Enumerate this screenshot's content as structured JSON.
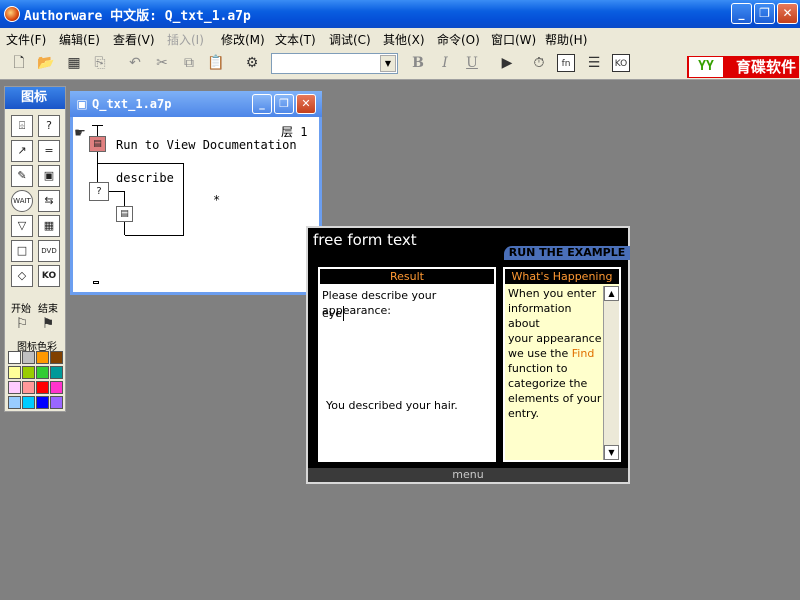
{
  "app": {
    "title": "Authorware 中文版: Q_txt_1.a7p"
  },
  "window_buttons": {
    "minimize": "_",
    "restore": "❐",
    "close": "✕"
  },
  "menu": [
    {
      "label": "文件(F)",
      "disabled": false
    },
    {
      "label": "编辑(E)",
      "disabled": false
    },
    {
      "label": "查看(V)",
      "disabled": false
    },
    {
      "label": "插入(I)",
      "disabled": true
    },
    {
      "label": "修改(M)",
      "disabled": false
    },
    {
      "label": "文本(T)",
      "disabled": false
    },
    {
      "label": "调试(C)",
      "disabled": false
    },
    {
      "label": "其他(X)",
      "disabled": false
    },
    {
      "label": "命令(O)",
      "disabled": false
    },
    {
      "label": "窗口(W)",
      "disabled": false
    },
    {
      "label": "帮助(H)",
      "disabled": false
    }
  ],
  "toolbar": {
    "font_combo_value": "",
    "bold": "B",
    "italic": "I",
    "underline": "U",
    "fn_label": "fn",
    "ko_label": "KO"
  },
  "brand": {
    "logo": "YY",
    "text": "育碟软件"
  },
  "palette": {
    "title": "图标",
    "icons": [
      {
        "name": "display-icon",
        "glyph": "⌹"
      },
      {
        "name": "decision-icon",
        "glyph": "?"
      },
      {
        "name": "motion-icon",
        "glyph": "↗"
      },
      {
        "name": "interaction-icon",
        "glyph": "="
      },
      {
        "name": "erase-icon",
        "glyph": "✎"
      },
      {
        "name": "calculation-icon",
        "glyph": "▣"
      },
      {
        "name": "wait-icon",
        "glyph": "WAIT"
      },
      {
        "name": "navigate-icon",
        "glyph": "⇆"
      },
      {
        "name": "framework-icon",
        "glyph": "▽"
      },
      {
        "name": "movie-icon",
        "glyph": "▦"
      },
      {
        "name": "map-icon",
        "glyph": "□"
      },
      {
        "name": "dvd-icon",
        "glyph": "DVD"
      },
      {
        "name": "sound-icon",
        "glyph": "◇"
      },
      {
        "name": "knowledge-object-icon",
        "glyph": "KO"
      }
    ],
    "start_label": "开始",
    "end_label": "结束",
    "color_label": "图标色彩",
    "colors": [
      "#ffffff",
      "#c0c0c0",
      "#ff9900",
      "#804000",
      "#ffff99",
      "#99cc00",
      "#33cc33",
      "#009999",
      "#ffccff",
      "#ff9999",
      "#ff0000",
      "#ff33cc",
      "#99ccff",
      "#00ccff",
      "#0000ff",
      "#9966ff"
    ]
  },
  "flow_window": {
    "title": "Q_txt_1.a7p",
    "level_label": "层 1",
    "icon1_label": "Run to View Documentation",
    "decision_label": "describe",
    "asterisk": "*"
  },
  "presentation": {
    "title": "free form text",
    "run_label": "RUN THE EXAMPLE",
    "result_header": "Result",
    "happening_header": "What's Happening",
    "prompt": "Please describe your appearance:",
    "input_value": "eye",
    "response": "You described your hair.",
    "explain_lines": [
      "When you enter",
      "information about",
      "your appearance",
      "we use the ",
      "function to",
      "categorize the",
      "elements of your",
      "entry."
    ],
    "find_word": "Find",
    "menu_label": "menu"
  }
}
